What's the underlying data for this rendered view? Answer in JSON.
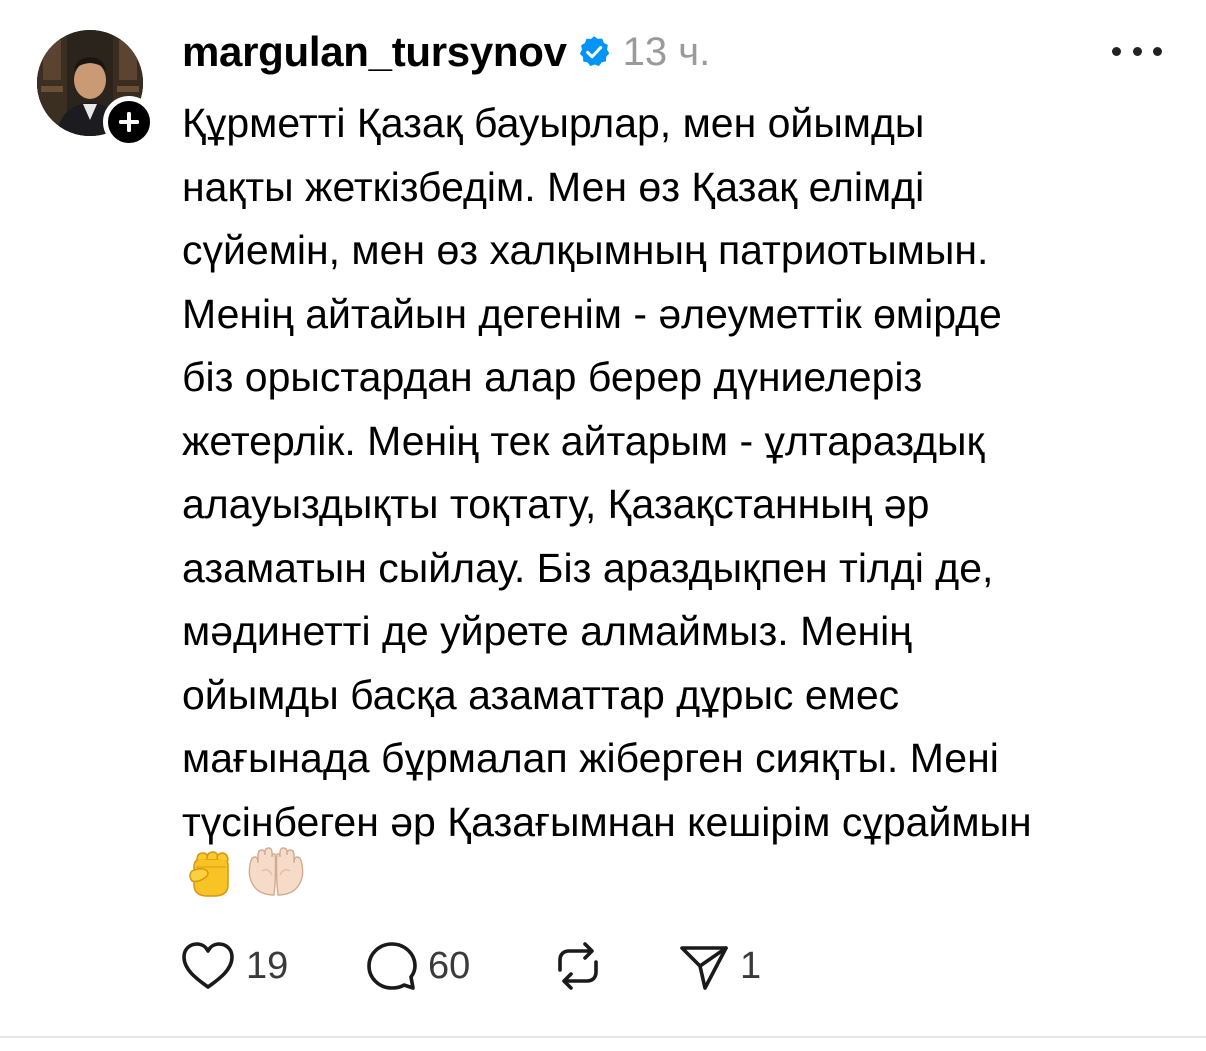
{
  "post": {
    "username": "margulan_tursynov",
    "timestamp": "13 ч.",
    "verified": true,
    "text_lines": [
      "Құрметті Қазақ бауырлар, мен ойымды",
      "нақты жеткізбедім. Мен өз Қазақ елімді",
      "сүйемін, мен өз халқымның патриотымын.",
      "Менің айтайын дегенім - әлеуметтік өмірде",
      "біз орыстардан алар берер дүниелеріз",
      "жетерлік. Менің тек айтарым - ұлтараздық",
      "алауыздықты тоқтату, Қазақстанның әр",
      "азаматын сыйлау. Біз араздықпен тілді де,",
      "мәдинетті де уйрете алмаймыз. Менің",
      "ойымды басқа азаматтар дұрыс емес",
      "мағынада бұрмалап жіберген сияқты. Мені",
      "түсінбеген әр Қазағымнан кешірім сұраймын"
    ],
    "emojis": [
      "raised-fist-emoji",
      "palms-up-together-emoji"
    ]
  },
  "actions": {
    "likes": "19",
    "replies": "60",
    "shares": "1"
  },
  "icons": {
    "avatar": "profile-photo",
    "follow": "plus-icon",
    "verified": "verified-badge-icon",
    "more": "more-icon",
    "like": "heart-icon",
    "reply": "comment-icon",
    "repost": "repost-icon",
    "share": "send-icon"
  },
  "colors": {
    "verified_blue": "#0095f6",
    "timestamp_gray": "#9a9a9a",
    "text": "#000000",
    "action_gray": "#3a3a3a"
  }
}
